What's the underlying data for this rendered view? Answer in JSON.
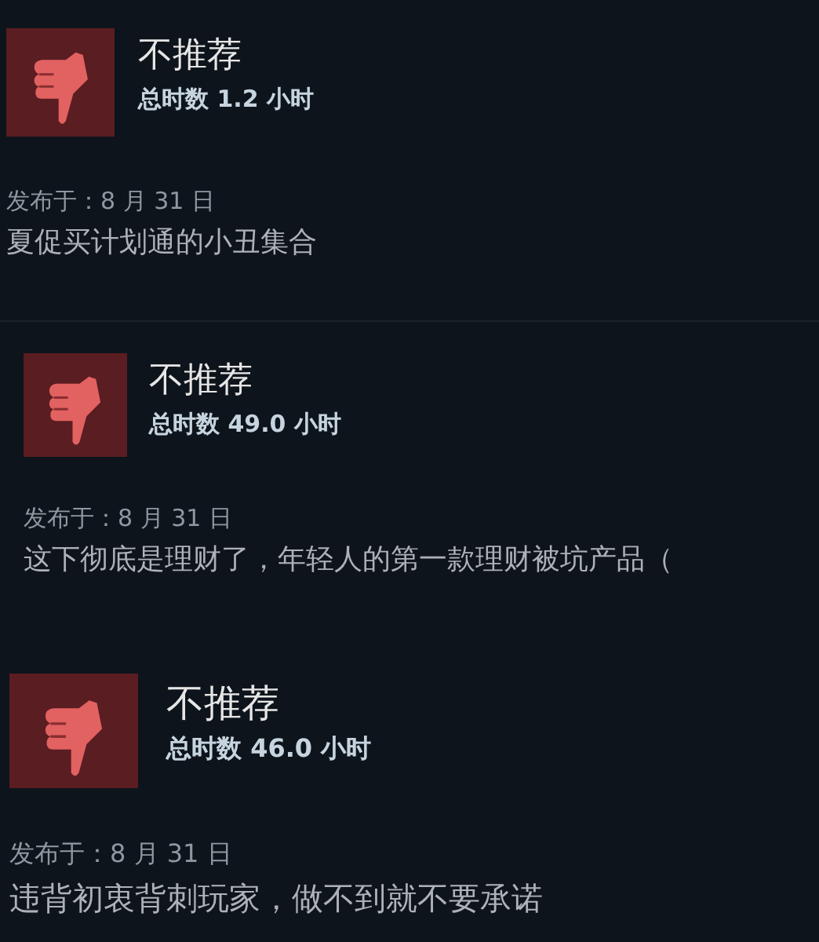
{
  "reviews": [
    {
      "recommended": false,
      "verdict": "不推荐",
      "hours": "总时数 1.2 小时",
      "posted": "发布于：8 月 31 日",
      "text": "夏促买计划通的小丑集合"
    },
    {
      "recommended": false,
      "verdict": "不推荐",
      "hours": "总时数 49.0 小时",
      "posted": "发布于：8 月 31 日",
      "text": "这下彻底是理财了，年轻人的第一款理财被坑产品（"
    },
    {
      "recommended": false,
      "verdict": "不推荐",
      "hours": "总时数 46.0 小时",
      "posted": "发布于：8 月 31 日",
      "text": "违背初衷背刺玩家，做不到就不要承诺"
    }
  ]
}
